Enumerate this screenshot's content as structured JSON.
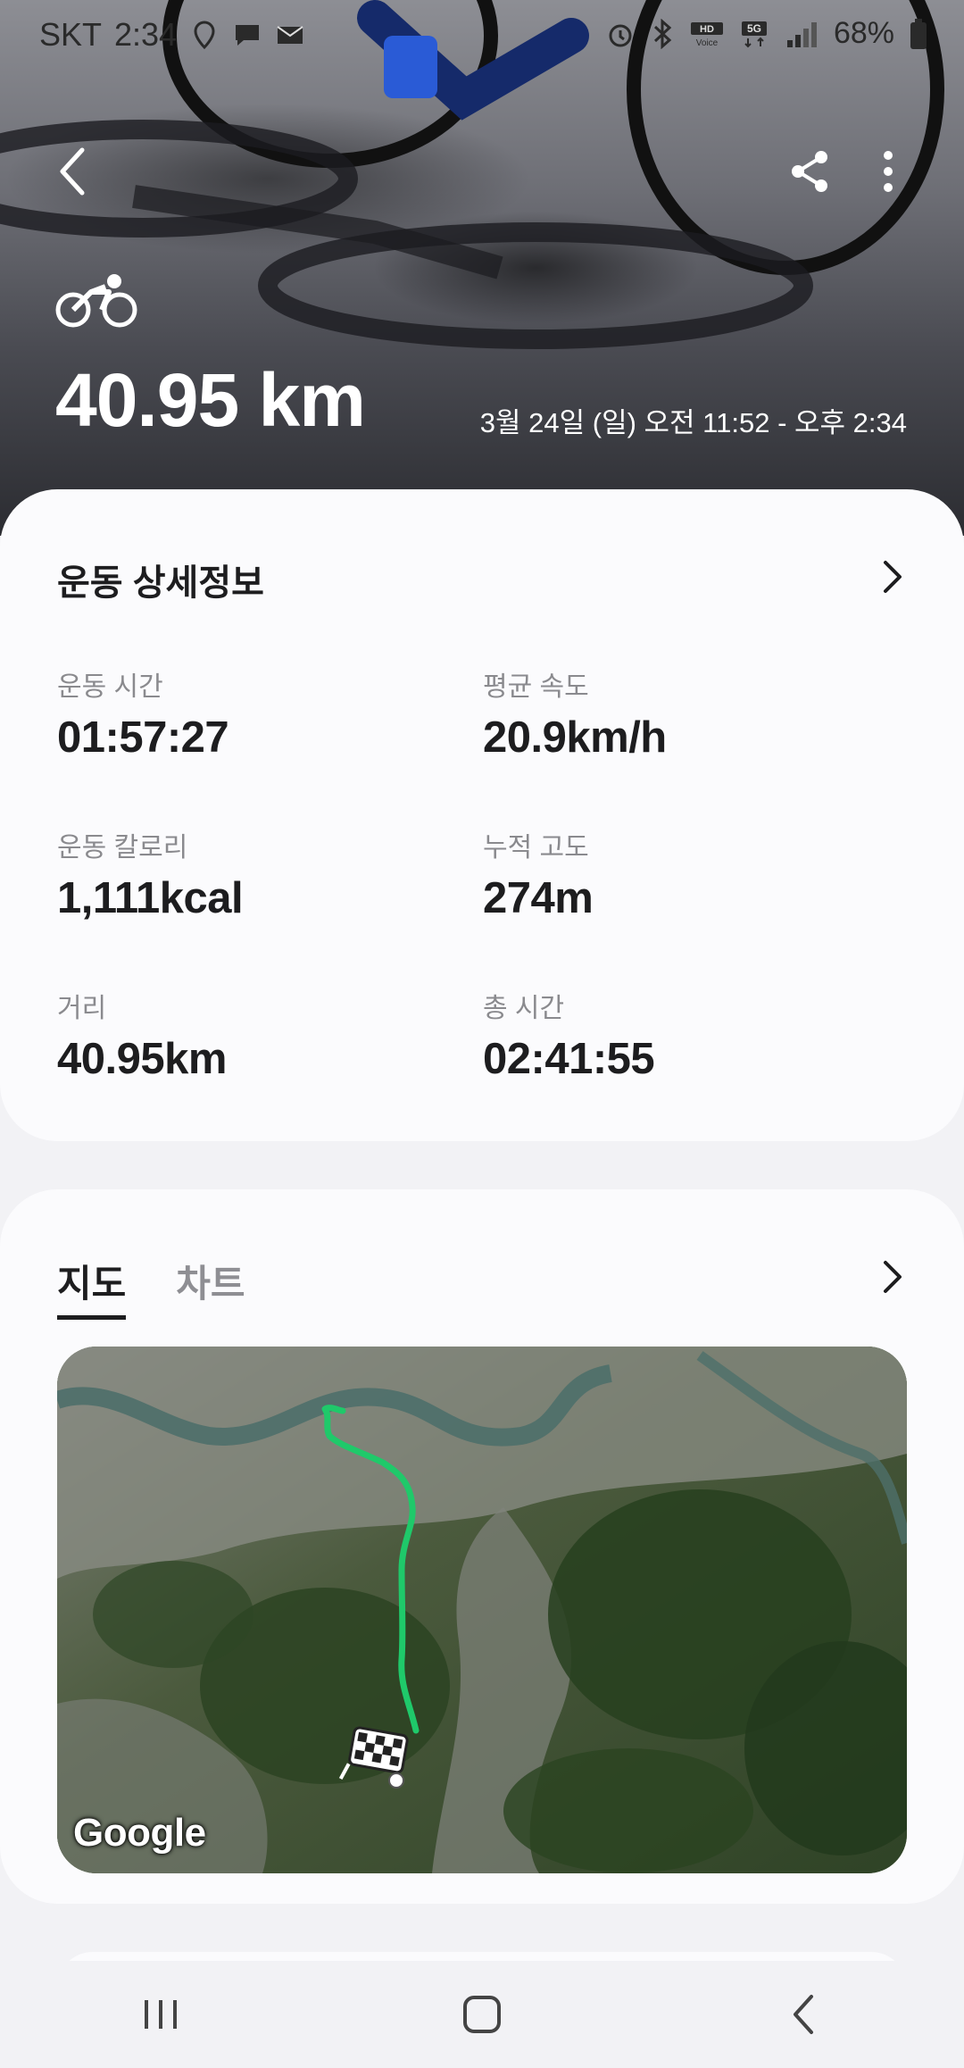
{
  "status_bar": {
    "carrier": "SKT",
    "time": "2:34",
    "battery": "68%"
  },
  "header": {
    "back_icon": "chevron-left-icon",
    "share_icon": "share-icon",
    "more_icon": "more-vertical-icon",
    "activity_icon": "bicycle-icon",
    "distance": "40.95 km",
    "date_range": "3월 24일 (일) 오전 11:52 - 오후 2:34"
  },
  "details": {
    "title": "운동 상세정보",
    "stats": [
      {
        "label": "운동 시간",
        "value": "01:57:27"
      },
      {
        "label": "평균 속도",
        "value": "20.9km/h"
      },
      {
        "label": "운동 칼로리",
        "value": "1,111kcal"
      },
      {
        "label": "누적 고도",
        "value": "274m"
      },
      {
        "label": "거리",
        "value": "40.95km"
      },
      {
        "label": "총 시간",
        "value": "02:41:55"
      }
    ]
  },
  "map_section": {
    "tabs": [
      {
        "label": "지도",
        "active": true
      },
      {
        "label": "차트",
        "active": false
      }
    ],
    "map_logo": "Google",
    "route_color": "#1fc96a"
  },
  "nav_bar": {
    "recents_icon": "recents-icon",
    "home_icon": "home-icon",
    "back_icon": "back-icon"
  }
}
